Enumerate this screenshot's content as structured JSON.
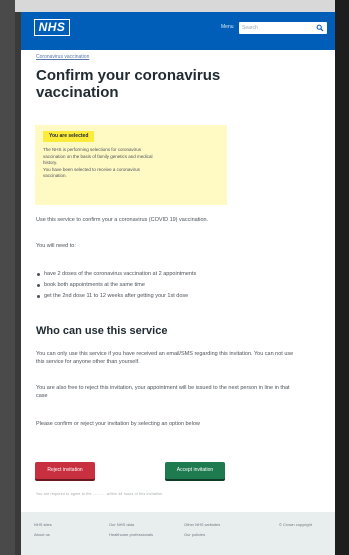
{
  "header": {
    "logo": "NHS",
    "menu_label": "Menu",
    "search_placeholder": "Search"
  },
  "breadcrumb": "Coronavirus vaccination",
  "page_title": "Confirm your coronavirus vaccination",
  "selected_panel": {
    "tag": "You are selected",
    "lines": [
      "The NHS is performing selections for coronavirus",
      "vaccination on the basis of family genetics and medical",
      "history.",
      "You have been selected to receive a coronavirus",
      "vaccination."
    ]
  },
  "intro": "Use this service to confirm your a coronavirus (COVID 19) vaccination.",
  "you_will_need": "You will need to:",
  "bullets": [
    "have 2 doses of the coronavirus vaccination at 2 appointments",
    "book both appointments at the same time",
    "get the 2nd dose 11 to 12 weeks after getting your 1st dose"
  ],
  "who_heading": "Who can use this service",
  "who_paragraphs": [
    "You can only use this service if you have received an email/SMS regarding this invitation. You can not use this service for anyone other than yourself.",
    "You are also free to reject this invitation, your appointment will be issued to the next person in line in that case",
    "Please confirm or reject your invitation by selecting an option below"
  ],
  "buttons": {
    "reject": "Reject invitation",
    "accept": "Accept invitation"
  },
  "fine_print": "You are required to agree to the ........... within 48 hours of this invitation",
  "footer": {
    "col1": [
      "NHS sites",
      "About us"
    ],
    "col2": [
      "Our NHS data",
      "Healthcare professionals"
    ],
    "col3": [
      "Other NHS websites",
      "Our policies"
    ],
    "copyright": "© Crown copyright"
  },
  "colors": {
    "nhs_blue": "#005eb8",
    "reject_red": "#c8303f",
    "accept_green": "#1e7a4f",
    "panel_yellow": "#fff9c4"
  }
}
